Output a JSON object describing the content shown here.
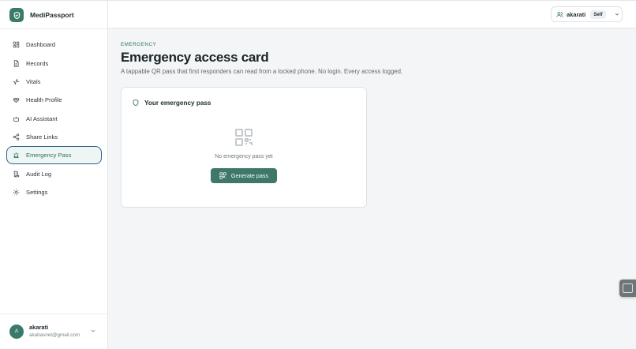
{
  "app": {
    "name": "MediPassport"
  },
  "sidebar": {
    "items": [
      {
        "label": "Dashboard",
        "icon": "dashboard-icon"
      },
      {
        "label": "Records",
        "icon": "file-icon"
      },
      {
        "label": "Vitals",
        "icon": "activity-icon"
      },
      {
        "label": "Health Profile",
        "icon": "heart-icon"
      },
      {
        "label": "AI Assistant",
        "icon": "bot-icon"
      },
      {
        "label": "Share Links",
        "icon": "share-icon"
      },
      {
        "label": "Emergency Pass",
        "icon": "siren-icon",
        "active": true
      },
      {
        "label": "Audit Log",
        "icon": "scroll-icon"
      },
      {
        "label": "Settings",
        "icon": "gear-icon"
      }
    ]
  },
  "user": {
    "initial": "A",
    "name": "akarati",
    "email": "akabasnet@gmail.com"
  },
  "header": {
    "profile_name": "akarati",
    "profile_badge": "Self"
  },
  "page": {
    "eyebrow": "EMERGENCY",
    "title": "Emergency access card",
    "subtitle": "A tappable QR pass that first responders can read from a locked phone. No login. Every access logged."
  },
  "card": {
    "title": "Your emergency pass",
    "empty_text": "No emergency pass yet",
    "button_label": "Generate pass"
  },
  "colors": {
    "accent": "#3a7a6a",
    "active_border": "#2f5f96",
    "background": "#f4f5f7"
  }
}
